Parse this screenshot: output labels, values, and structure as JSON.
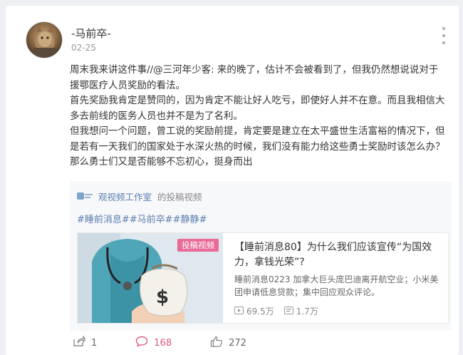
{
  "post": {
    "author": "-马前卒-",
    "date": "02-25",
    "paragraphs": [
      "周末我来讲这件事//@三河年少客: 来的晚了，估计不会被看到了，但我仍然想说说对于援鄂医疗人员奖励的看法。",
      "首先奖励我肯定是赞同的，因为肯定不能让好人吃亏，即使好人并不在意。而且我相信大多去前线的医务人员也并不是为了名利。",
      "但我想问一个问题，曾工说的奖励前提，肯定要是建立在太平盛世生活富裕的情况下，但是若有一天我们的国家处于水深火热的时候，我们没有能力给这些勇士奖励时该怎么办？那么勇士们又是否能够不忘初心，挺身而出"
    ]
  },
  "repost": {
    "source_name": "观视频工作室",
    "source_desc": "的投稿视频",
    "tags": "#睡前消息##马前卒##静静#",
    "video": {
      "badge": "投稿视频",
      "title": "【睡前消息80】为什么我们应该宣传“为国效力，拿钱光荣”?",
      "desc": "睡前消息0223 加拿大巨头庞巴迪离开航空业；小米美团申请低息贷款；集中回应观众评论。",
      "plays": "69.5万",
      "danmaku": "1.7万"
    }
  },
  "actions": {
    "share_count": "1",
    "comment_count": "168",
    "like_count": "272"
  },
  "colors": {
    "link": "#5c7fb0",
    "comment_accent": "#e05a7a",
    "badge": "#e96a98"
  }
}
